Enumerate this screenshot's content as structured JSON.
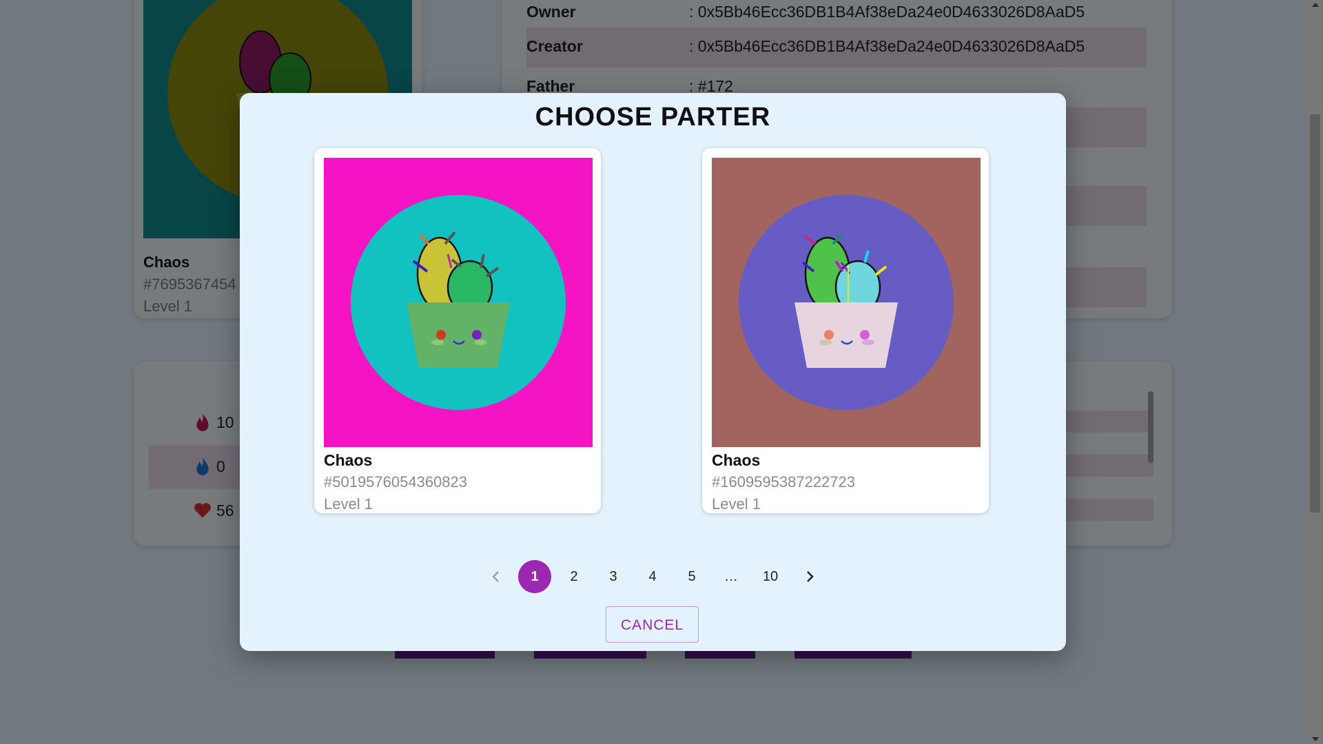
{
  "background": {
    "nft_card": {
      "name": "Chaos",
      "id": "#7695367454",
      "level": "Level 1"
    },
    "info_rows": [
      {
        "key": "Owner",
        "value": ": 0x5Bb46Ecc36DB1B4Af38eDa24e0D4633026D8AaD5"
      },
      {
        "key": "Creator",
        "value": ": 0x5Bb46Ecc36DB1B4Af38eDa24e0D4633026D8AaD5"
      },
      {
        "key": "Father",
        "value": ": #172"
      }
    ],
    "stats": [
      {
        "icon": "fire-icon",
        "value": "10"
      },
      {
        "icon": "water-drop-icon",
        "value": "0"
      },
      {
        "icon": "heart-icon",
        "value": "56"
      }
    ]
  },
  "modal": {
    "title": "CHOOSE PARTER",
    "partners": [
      {
        "name": "Chaos",
        "id": "#5019576054360823",
        "level": "Level 1",
        "colors": {
          "background": "#f514c4",
          "circle": "#12c2c0",
          "pot": "#64b268",
          "cactus_back": "#c9c337",
          "cactus_front": "#2bb865"
        }
      },
      {
        "name": "Chaos",
        "id": "#1609595387222723",
        "level": "Level 1",
        "colors": {
          "background": "#a2645f",
          "circle": "#665cc4",
          "pot": "#e7d4df",
          "cactus_back": "#4fc24a",
          "cactus_front": "#6fd6de"
        }
      }
    ],
    "pagination": {
      "pages": [
        "1",
        "2",
        "3",
        "4",
        "5",
        "…",
        "10"
      ],
      "current": "1"
    },
    "cancel_label": "CANCEL"
  },
  "colors": {
    "accent": "#9c27b0",
    "modal_bg": "#e3f2fd",
    "dark_button": "#6a1b9a"
  }
}
